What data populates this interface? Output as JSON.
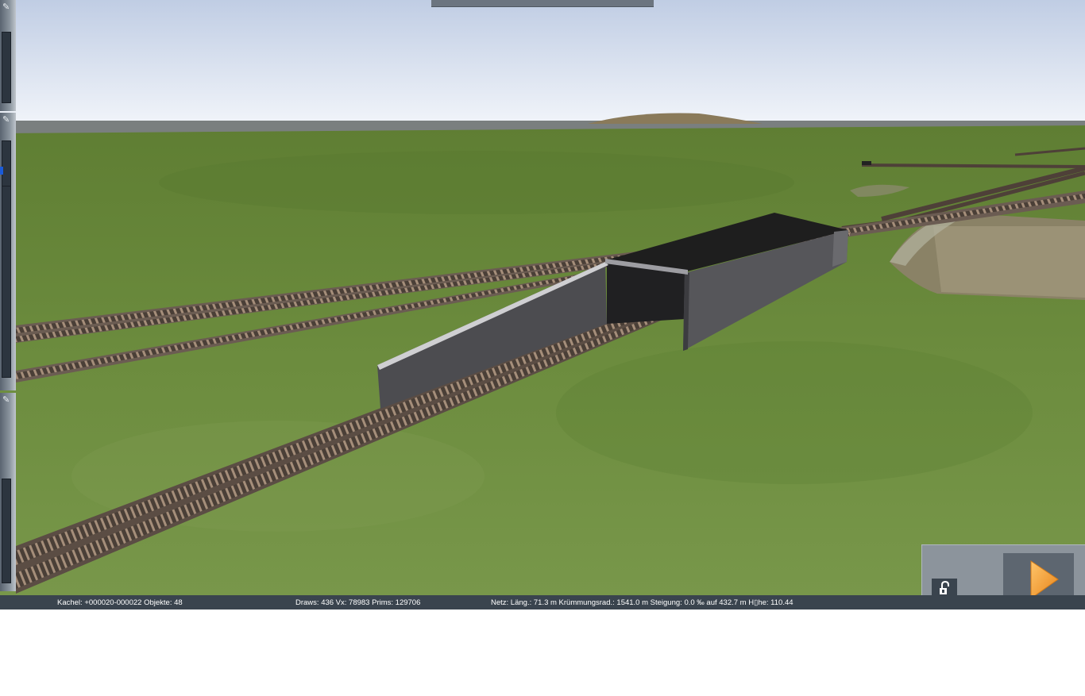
{
  "status": {
    "tile": "Kachel: +000020-000022  Objekte: 48",
    "render_stats": "Draws: 436 Vx: 78983 Prims: 129706",
    "track_info": "Netz:  Läng.:   71.3 m Krümmungsrad.: 1541.0 m Steigung:  0.0 ‰ auf 432.7 m H▯he: 110.44"
  },
  "icons": {
    "panel_pin": "pin-icon",
    "lock": "lock-open-icon",
    "play": "play-icon"
  },
  "colors": {
    "sky_top": "#c0cde4",
    "sky_bottom": "#f2f5fa",
    "grass": "#6f8f3f",
    "statusbar": "#3a444e",
    "play_orange": "#f39a2c"
  }
}
